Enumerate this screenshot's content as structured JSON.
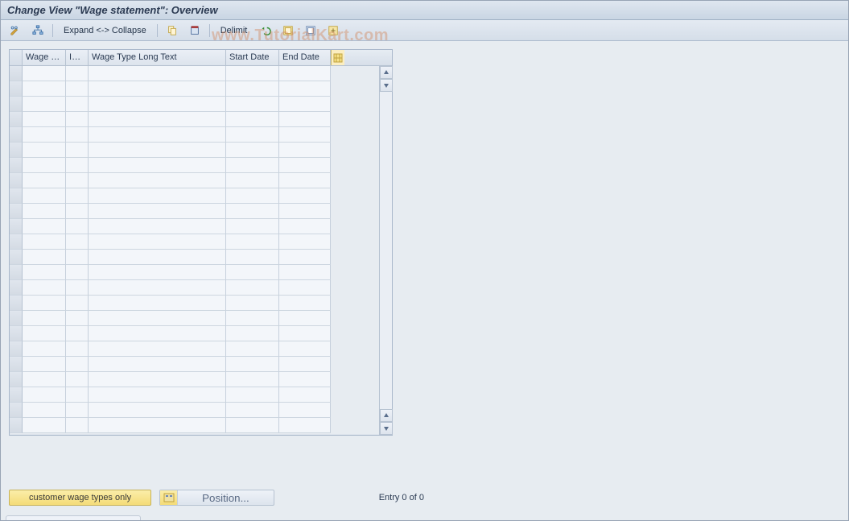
{
  "title": "Change View \"Wage statement\": Overview",
  "watermark": "www.TutorialKart.com",
  "toolbar": {
    "expand_collapse": "Expand <-> Collapse",
    "delimit": "Delimit"
  },
  "table": {
    "columns": {
      "wage_type": "Wage Ty...",
      "inf": "Inf...",
      "long_text": "Wage Type Long Text",
      "start_date": "Start Date",
      "end_date": "End Date"
    },
    "row_count": 24
  },
  "footer": {
    "customer_button": "customer wage types only",
    "position_button": "Position...",
    "entry_text": "Entry 0 of 0"
  }
}
